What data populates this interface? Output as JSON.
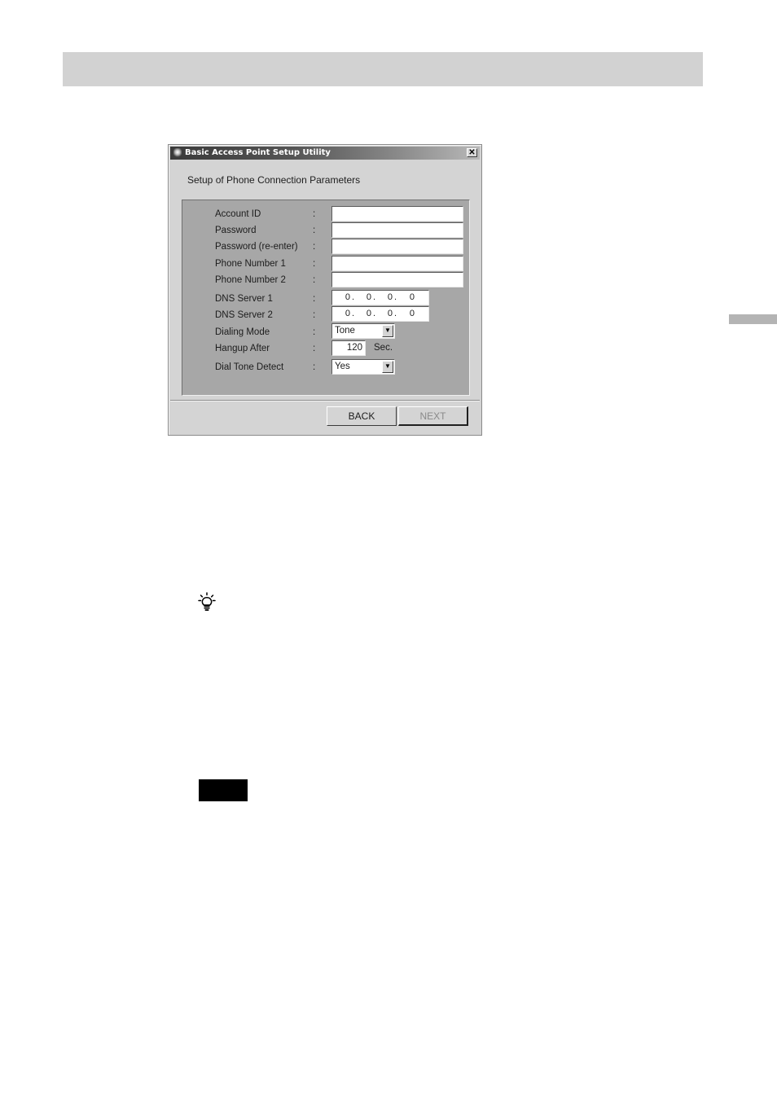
{
  "window": {
    "title": "Basic Access Point Setup Utility",
    "close_glyph": "✕"
  },
  "form": {
    "heading": "Setup of Phone Connection Parameters",
    "separator": ":",
    "fields": {
      "account_id": {
        "label": "Account ID",
        "value": ""
      },
      "password": {
        "label": "Password",
        "value": ""
      },
      "password_reenter": {
        "label": "Password (re-enter)",
        "value": ""
      },
      "phone1": {
        "label": "Phone Number 1",
        "value": ""
      },
      "phone2": {
        "label": "Phone Number 2",
        "value": ""
      },
      "dns1": {
        "label": "DNS Server 1",
        "octets": [
          "0",
          "0",
          "0",
          "0"
        ]
      },
      "dns2": {
        "label": "DNS Server 2",
        "octets": [
          "0",
          "0",
          "0",
          "0"
        ]
      },
      "dialing_mode": {
        "label": "Dialing Mode",
        "value": "Tone"
      },
      "hangup_after": {
        "label": "Hangup After",
        "value": "120",
        "unit": "Sec."
      },
      "dial_tone_detect": {
        "label": "Dial Tone Detect",
        "value": "Yes"
      }
    }
  },
  "buttons": {
    "back": "BACK",
    "next": "NEXT",
    "next_enabled": false
  },
  "icons": {
    "dropdown": "chevron-down-icon",
    "tip": "lightbulb-icon",
    "app": "app-icon"
  },
  "colors": {
    "page_background": "#ffffff",
    "header_band": "#d2d2d2",
    "dialog_face": "#d4d4d4",
    "group_panel": "#a7a7a7",
    "note_block": "#000000"
  }
}
